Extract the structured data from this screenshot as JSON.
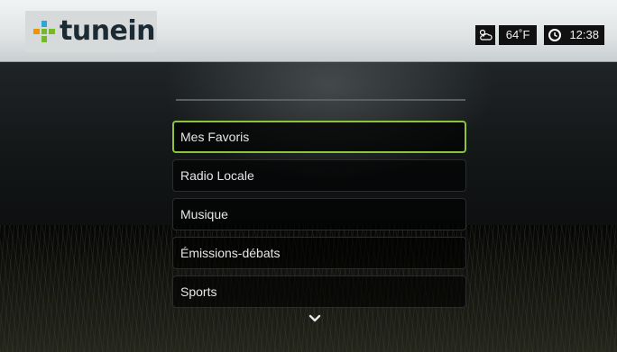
{
  "header": {
    "logo_text": "tunein",
    "weather_icon": "cloud-sun-icon",
    "temperature": "64˚F",
    "clock_icon": "clock-icon",
    "time": "12:38"
  },
  "menu": {
    "items": [
      {
        "label": "Mes Favoris",
        "selected": true
      },
      {
        "label": "Radio Locale",
        "selected": false
      },
      {
        "label": "Musique",
        "selected": false
      },
      {
        "label": "Émissions-débats",
        "selected": false
      },
      {
        "label": "Sports",
        "selected": false
      }
    ],
    "more_icon": "chevron-down-icon"
  },
  "colors": {
    "selection_accent": "#8cc43c",
    "logo_green": "#76b82a",
    "logo_orange": "#f39200",
    "logo_blue": "#29a8e0",
    "logo_text": "#1c2b33"
  }
}
